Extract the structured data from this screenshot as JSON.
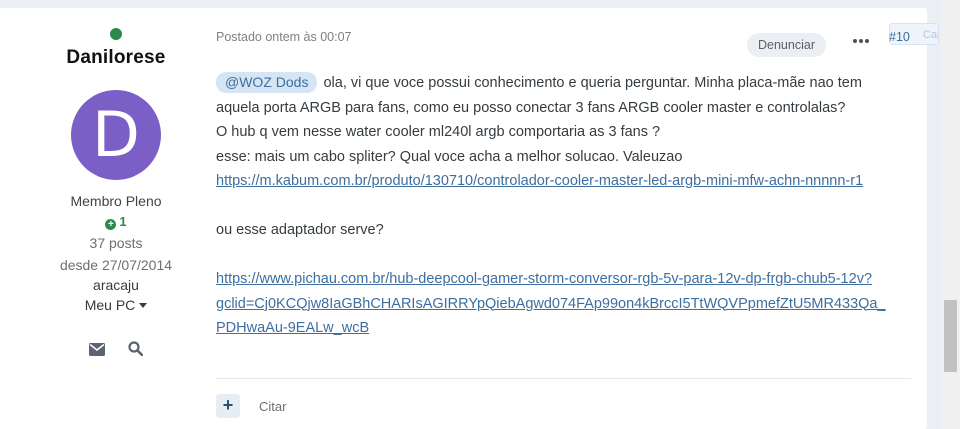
{
  "author": {
    "name": "Danilorese",
    "avatar_letter": "D",
    "avatar_color": "#7b5fc6",
    "online_color": "#2e8a4b",
    "rank": "Membro Pleno",
    "reputation": "1",
    "posts": "37 posts",
    "joined": "desde 27/07/2014",
    "location": "aracaju",
    "pc_label": "Meu PC",
    "icons": [
      "envelope-icon",
      "search-icon"
    ]
  },
  "post": {
    "meta": "Postado ontem às 00:07",
    "report_label": "Denunciar",
    "number": "#10",
    "capture_label": "Captura",
    "mention": "@WOZ Dods",
    "line1_text": " ola, vi que voce possui conhecimento e queria perguntar. Minha placa-mãe nao tem",
    "line2": "aquela porta ARGB para fans, como eu posso conectar 3 fans ARGB cooler master e controlalas?",
    "line3": "O hub q vem nesse water cooler ml240l argb comportaria as 3 fans ?",
    "line4": "esse: mais um cabo spliter? Qual voce acha a melhor solucao. Valeuzao",
    "link1": "https://m.kabum.com.br/produto/130710/controlador-cooler-master-led-argb-mini-mfw-achn-nnnnn-r1",
    "line5": "ou esse adaptador serve?",
    "link2_a": "https://www.pichau.com.br/hub-deepcool-gamer-storm-conversor-rgb-5v-para-12v-dp-frgb-chub5-12v?",
    "link2_b": "gclid=Cj0KCQjw8IaGBhCHARIsAGIRRYpQiebAgwd074FAp99on4kBrccI5TtWQVPpmefZtU5MR433Qa_",
    "link2_c": "PDHwaAu-9EALw_wcB",
    "add_label": "+",
    "quote_label": "Citar"
  },
  "colors": {
    "link": "#3d6ea0",
    "reputation": "#2e8a4b",
    "page_background": "#ebeef2"
  }
}
